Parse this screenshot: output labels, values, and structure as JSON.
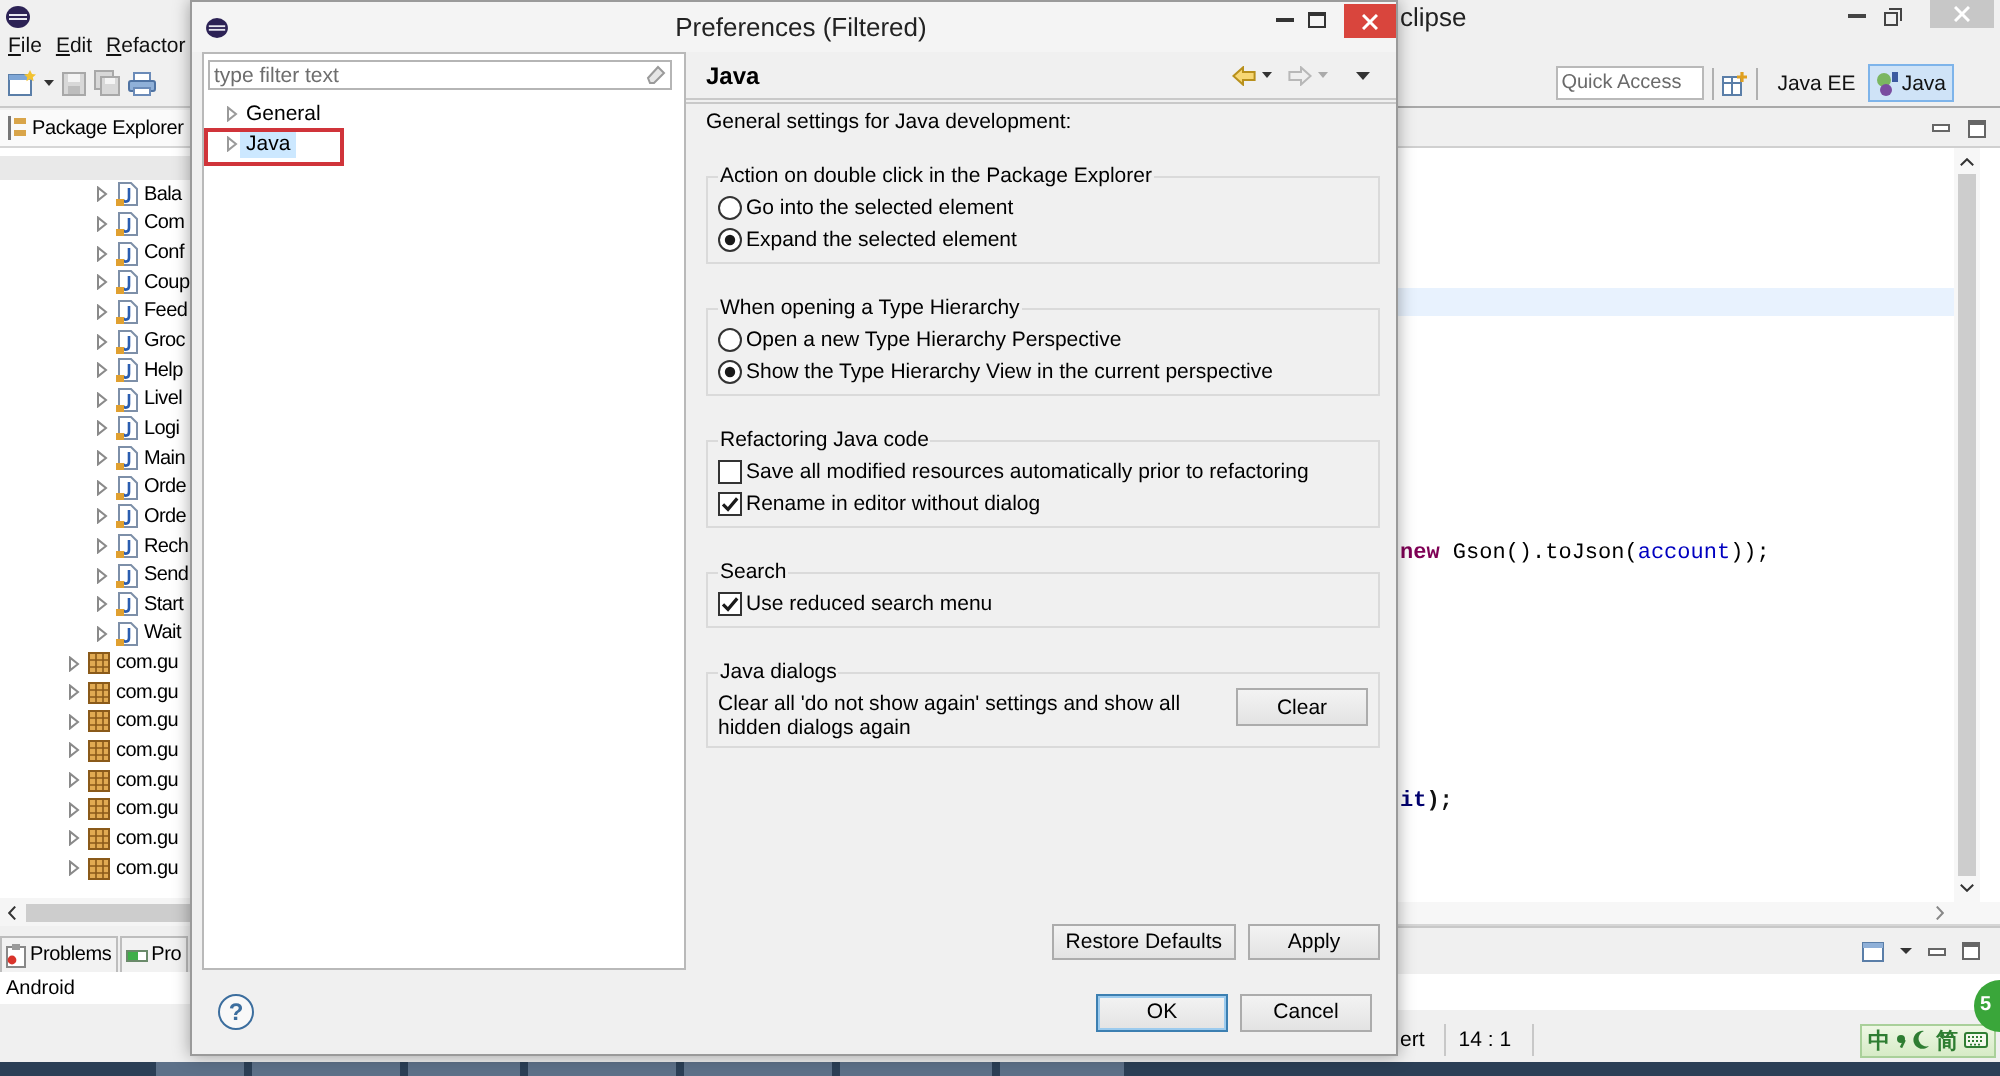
{
  "ide": {
    "title": "clipse",
    "menu": [
      "File",
      "Edit",
      "Refactor"
    ],
    "quick_access": {
      "placeholder": "Quick Access"
    },
    "perspectives": [
      {
        "label": "Java EE",
        "kind": "text",
        "selected": false
      },
      {
        "label": "Java",
        "kind": "icon_text",
        "selected": true
      }
    ],
    "package_explorer": {
      "title": "Package Explorer",
      "selected": true,
      "tree": [
        {
          "children": [
            {
              "label": "Bala",
              "kind": "java_file",
              "expanded": false
            },
            {
              "label": "Com",
              "kind": "java_file",
              "expanded": false
            },
            {
              "label": "Conf",
              "kind": "java_file",
              "expanded": false
            },
            {
              "label": "Coup",
              "kind": "java_file",
              "expanded": false
            },
            {
              "label": "Feed",
              "kind": "java_file",
              "expanded": false
            },
            {
              "label": "Groc",
              "kind": "java_file",
              "expanded": false
            },
            {
              "label": "Help",
              "kind": "java_file",
              "expanded": false
            },
            {
              "label": "Livel",
              "kind": "java_file",
              "expanded": false
            },
            {
              "label": "Logi",
              "kind": "java_file",
              "expanded": false
            },
            {
              "label": "Main",
              "kind": "java_file",
              "expanded": false
            },
            {
              "label": "Orde",
              "kind": "java_file",
              "expanded": false
            },
            {
              "label": "Orde",
              "kind": "java_file",
              "expanded": false
            },
            {
              "label": "Rech",
              "kind": "java_file",
              "expanded": false
            },
            {
              "label": "Send",
              "kind": "java_file",
              "expanded": false
            },
            {
              "label": "Start",
              "kind": "java_file",
              "expanded": false
            },
            {
              "label": "Wait",
              "kind": "java_file",
              "expanded": false
            }
          ]
        },
        {
          "label": "com.gu",
          "kind": "package",
          "expanded": false
        },
        {
          "label": "com.gu",
          "kind": "package",
          "expanded": false
        },
        {
          "label": "com.gu",
          "kind": "package",
          "expanded": false
        },
        {
          "label": "com.gu",
          "kind": "package",
          "expanded": false
        },
        {
          "label": "com.gu",
          "kind": "package",
          "expanded": false
        },
        {
          "label": "com.gu",
          "kind": "package",
          "expanded": false
        },
        {
          "label": "com.gu",
          "kind": "package",
          "expanded": false
        },
        {
          "label": "com.gu",
          "kind": "package",
          "expanded": false
        }
      ]
    },
    "bottom_tabs": [
      {
        "label": "Problems",
        "kind": "problems",
        "selected": false
      },
      {
        "label": "Pro",
        "kind": "progress",
        "selected": false
      }
    ],
    "bottom_panel": {
      "rows": [
        "Android"
      ]
    },
    "editor": {
      "lines": [
        {
          "tokens": [
            {
              "text": "new",
              "kind": "keyword"
            },
            {
              "text": " Gson().toJson(",
              "kind": "plain"
            },
            {
              "text": "account",
              "kind": "field"
            },
            {
              "text": "));",
              "kind": "plain"
            }
          ]
        },
        {
          "tokens": [
            {
              "text": "it",
              "kind": "strong_field"
            },
            {
              "text": ");",
              "kind": "strong"
            }
          ]
        }
      ]
    },
    "status": {
      "insert_mode": "ert",
      "position": "14 : 1"
    },
    "ime": {
      "mode": "中",
      "label": "简"
    },
    "badge": {
      "text": "5"
    }
  },
  "dialog": {
    "title": "Preferences (Filtered)",
    "filter": {
      "placeholder": "type filter text"
    },
    "tree": [
      {
        "label": "General",
        "expanded": false,
        "selected": false,
        "annotated": false
      },
      {
        "label": "Java",
        "expanded": false,
        "selected": true,
        "annotated": true
      }
    ],
    "page": {
      "title": "Java",
      "nav": [
        {
          "kind": "back",
          "disabled": false
        },
        {
          "kind": "forward",
          "disabled": true
        }
      ],
      "description": "General settings for Java development:",
      "groups": [
        {
          "title": "Action on double click in the Package Explorer",
          "kind": "radio",
          "options": [
            {
              "label": "Go into the selected element",
              "selected": false
            },
            {
              "label": "Expand the selected element",
              "selected": true
            }
          ]
        },
        {
          "title": "When opening a Type Hierarchy",
          "kind": "radio",
          "options": [
            {
              "label": "Open a new Type Hierarchy Perspective",
              "selected": false
            },
            {
              "label": "Show the Type Hierarchy View in the current perspective",
              "selected": true
            }
          ]
        },
        {
          "title": "Refactoring Java code",
          "kind": "checkbox",
          "options": [
            {
              "label": "Save all modified resources automatically prior to refactoring",
              "checked": false
            },
            {
              "label": "Rename in editor without dialog",
              "checked": true
            }
          ]
        },
        {
          "title": "Search",
          "kind": "checkbox",
          "options": [
            {
              "label": "Use reduced search menu",
              "checked": true
            }
          ]
        },
        {
          "title": "Java dialogs",
          "kind": "action",
          "text": "Clear all 'do not show again' settings and show all hidden dialogs again",
          "button": "Clear"
        }
      ],
      "buttons": [
        "Restore Defaults",
        "Apply"
      ]
    },
    "help": "?",
    "buttons": [
      {
        "label": "OK",
        "default": true
      },
      {
        "label": "Cancel",
        "default": false
      }
    ]
  }
}
